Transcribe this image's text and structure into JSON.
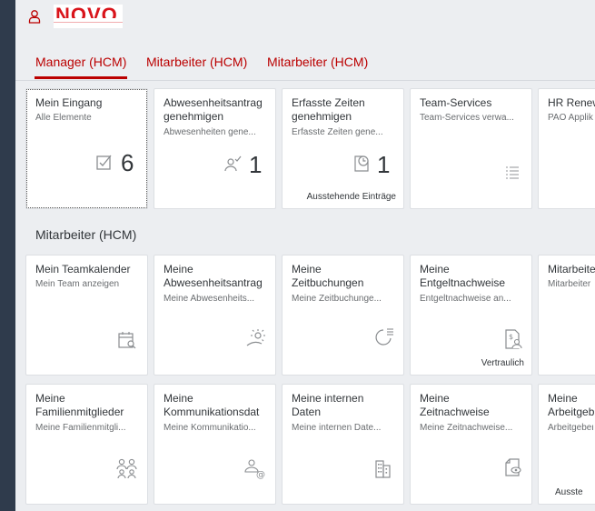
{
  "header": {
    "logo_text": "NOVO"
  },
  "tabs": [
    {
      "label": "Manager (HCM)",
      "active": true
    },
    {
      "label": "Mitarbeiter (HCM)",
      "active": false
    },
    {
      "label": "Mitarbeiter (HCM)",
      "active": false
    }
  ],
  "group1": {
    "tiles": [
      {
        "title": "Mein Eingang",
        "subtitle": "Alle Elemente",
        "count": "6",
        "icon": "checkbox-icon"
      },
      {
        "title1": "Abwesenheitsantrag",
        "title2": "genehmigen",
        "subtitle": "Abwesenheiten gene...",
        "count": "1",
        "icon": "person-check-icon"
      },
      {
        "title1": "Erfasste Zeiten",
        "title2": "genehmigen",
        "subtitle": "Erfasste Zeiten gene...",
        "count": "1",
        "footer": "Ausstehende Einträge",
        "icon": "time-document-icon"
      },
      {
        "title": "Team-Services",
        "subtitle": "Team-Services verwa...",
        "icon": "list-icon"
      },
      {
        "title": "HR Renew",
        "subtitle": "PAO Applik",
        "icon": ""
      }
    ]
  },
  "group2": {
    "title": "Mitarbeiter (HCM)",
    "row1": [
      {
        "title1": "Mein Teamkalender",
        "subtitle": "Mein Team anzeigen",
        "icon": "calendar-search-icon"
      },
      {
        "title1": "Meine",
        "title2": "Abwesenheitsantrag",
        "subtitle": "Meine Abwesenheits...",
        "icon": "leisure-sun-icon"
      },
      {
        "title1": "Meine",
        "title2": "Zeitbuchungen",
        "subtitle": "Meine Zeitbuchunge...",
        "icon": "time-list-icon"
      },
      {
        "title1": "Meine",
        "title2": "Entgeltnachweise",
        "subtitle": "Entgeltnachweise an...",
        "footer": "Vertraulich",
        "icon": "payslip-icon"
      },
      {
        "title1": "Mitarbeite",
        "subtitle": "Mitarbeiter",
        "icon": ""
      }
    ],
    "row2": [
      {
        "title1": "Meine",
        "title2": "Familienmitglieder",
        "subtitle": "Meine Familienmitgli...",
        "icon": "family-icon"
      },
      {
        "title1": "Meine",
        "title2": "Kommunikationsdat",
        "subtitle": "Meine Kommunikatio...",
        "icon": "contact-email-icon"
      },
      {
        "title1": "Meine internen",
        "title2": "Daten",
        "subtitle": "Meine internen Date...",
        "icon": "building-icon"
      },
      {
        "title1": "Meine",
        "title2": "Zeitnachweise",
        "subtitle": "Meine Zeitnachweise...",
        "icon": "document-view-icon"
      },
      {
        "title1": "Meine",
        "title2": "Arbeitgeb",
        "subtitle": "Arbeitgeber",
        "footer": "Ausste",
        "icon": ""
      }
    ]
  },
  "colors": {
    "accent": "#bb0000",
    "shell_bg": "#eceef1",
    "tile_bg": "#ffffff",
    "frame": "#2f3b4c"
  }
}
